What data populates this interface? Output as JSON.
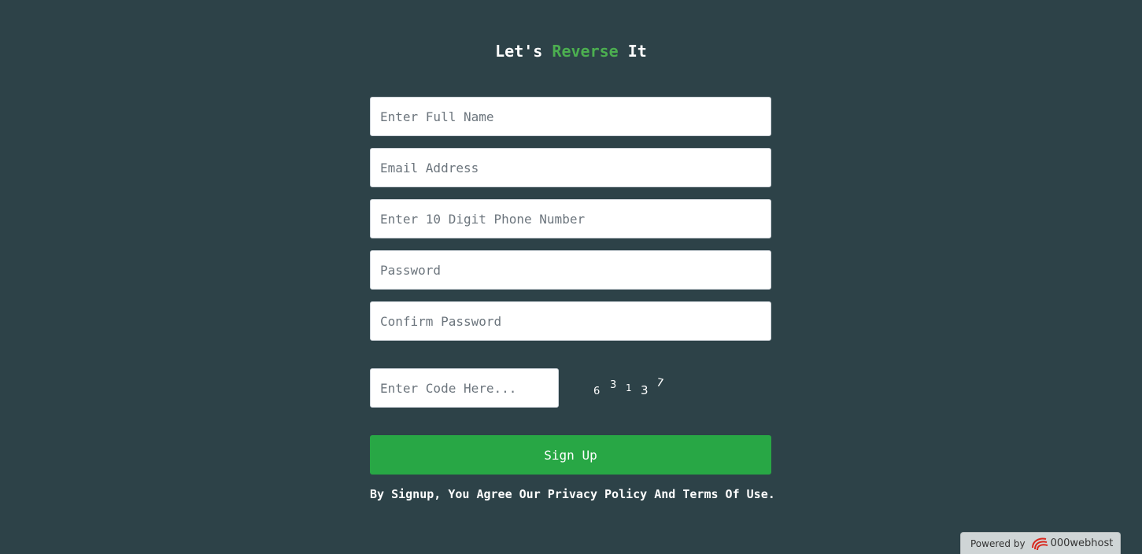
{
  "title": {
    "prefix": "Let's",
    "accent": "Reverse",
    "suffix": "It"
  },
  "form": {
    "full_name_placeholder": "Enter Full Name",
    "email_placeholder": "Email Address",
    "phone_placeholder": "Enter 10 Digit Phone Number",
    "password_placeholder": "Password",
    "confirm_password_placeholder": "Confirm Password",
    "code_placeholder": "Enter Code Here...",
    "captcha_digits": [
      "6",
      "3",
      "1",
      "3",
      "7"
    ],
    "signup_label": "Sign Up",
    "agreement_text": "By Signup, You Agree Our Privacy Policy And Terms Of Use."
  },
  "footer": {
    "powered_by": "Powered by",
    "brand": "000webhost",
    "logo_icon": "000webhost-logo-icon"
  },
  "colors": {
    "background": "#2d4248",
    "accent_green": "#4caf50",
    "button_green": "#28a745"
  }
}
